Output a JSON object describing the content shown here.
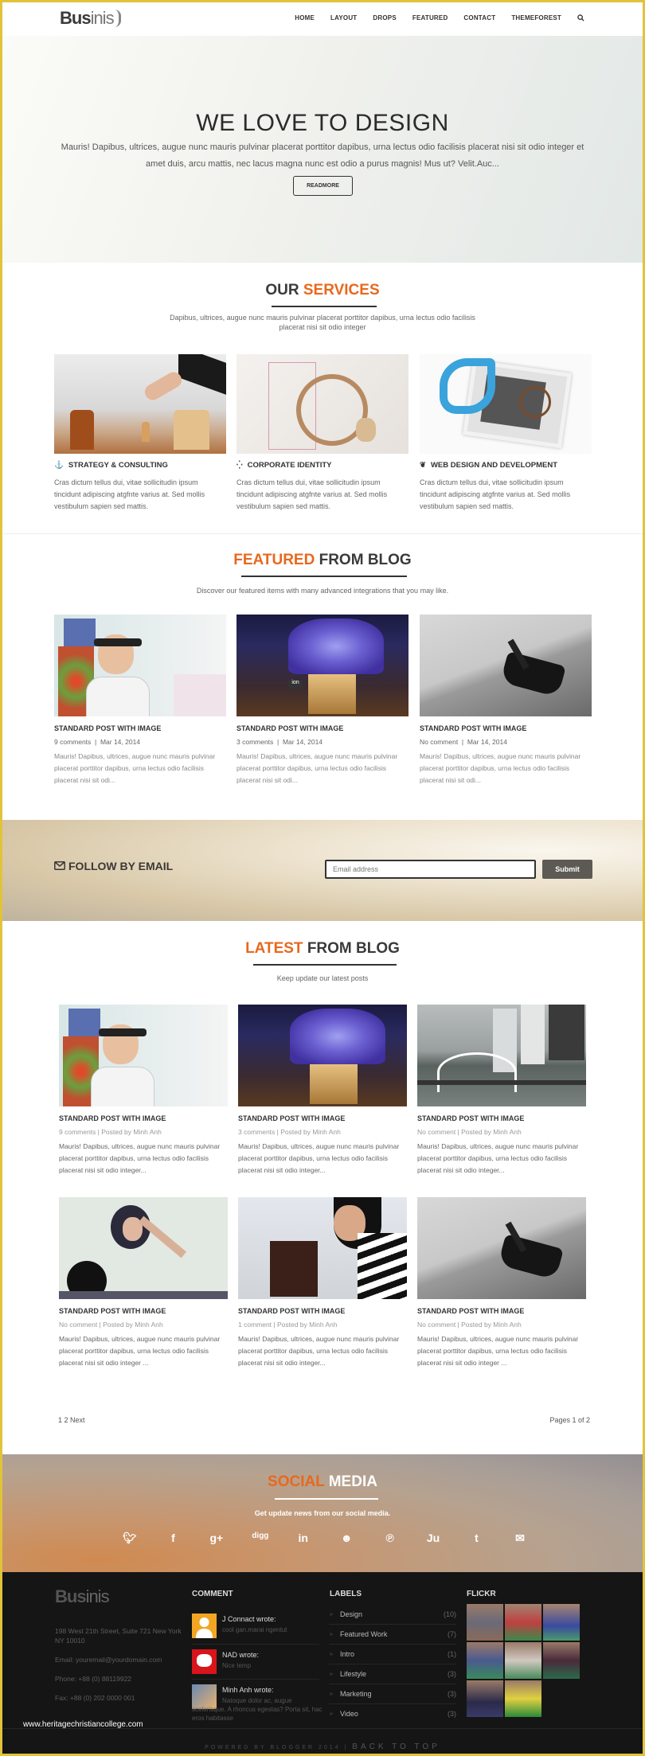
{
  "header": {
    "logo_bold": "Bus",
    "logo_light": "inis",
    "nav": [
      "HOME",
      "LAYOUT",
      "DROPS",
      "FEATURED",
      "CONTACT",
      "THEMEFOREST"
    ],
    "search_icon": "search-icon"
  },
  "hero": {
    "title": "WE LOVE TO DESIGN",
    "text": "Mauris! Dapibus, ultrices, augue nunc mauris pulvinar placerat porttitor dapibus, urna lectus odio facilisis placerat nisi sit odio integer et amet duis, arcu mattis, nec lacus magna nunc est odio a purus magnis! Mus ut? Velit.Auc...",
    "button": "READMORE"
  },
  "services": {
    "title_dark": "OUR",
    "title_accent": "SERVICES",
    "subtitle": "Dapibus, ultrices, augue nunc mauris pulvinar placerat porttitor dapibus, urna lectus odio facilisis placerat nisi sit odio integer",
    "items": [
      {
        "icon": "anchor-icon",
        "glyph": "⚓",
        "title": "STRATEGY & CONSULTING",
        "text": "Cras dictum tellus dui, vitae sollicitudin ipsum tincidunt adipiscing atgfnte varius at. Sed mollis vestibulum sapien sed mattis."
      },
      {
        "icon": "spinner-icon",
        "glyph": "⁛",
        "title": "CORPORATE IDENTITY",
        "text": "Cras dictum tellus dui, vitae sollicitudin ipsum tincidunt adipiscing atgfnte varius at. Sed mollis vestibulum sapien sed mattis."
      },
      {
        "icon": "leaf-icon",
        "glyph": "❦",
        "title": "WEB DESIGN AND DEVELOPMENT",
        "text": "Cras dictum tellus dui, vitae sollicitudin ipsum tincidunt adipiscing atgfnte varius at. Sed mollis vestibulum sapien sed mattis."
      }
    ]
  },
  "featured": {
    "title_accent": "FEATURED",
    "title_dark": "FROM BLOG",
    "subtitle": "Discover our featured items with many advanced integrations that you may like.",
    "posts": [
      {
        "title": "STANDARD POST WITH IMAGE",
        "comments": "9 comments",
        "date": "Mar 14, 2014",
        "excerpt": "Mauris! Dapibus, ultrices, augue nunc mauris pulvinar placerat porttitor dapibus, urna lectus odio facilisis placerat nisi sit odi..."
      },
      {
        "title": "STANDARD POST WITH IMAGE",
        "comments": "3 comments",
        "date": "Mar 14, 2014",
        "excerpt": "Mauris! Dapibus, ultrices, augue nunc mauris pulvinar placerat porttitor dapibus, urna lectus odio facilisis placerat nisi sit odi..."
      },
      {
        "title": "STANDARD POST WITH IMAGE",
        "comments": "No comment",
        "date": "Mar 14, 2014",
        "excerpt": "Mauris! Dapibus, ultrices, augue nunc mauris pulvinar placerat porttitor dapibus, urna lectus odio facilisis placerat nisi sit odi..."
      }
    ]
  },
  "follow": {
    "title": "FOLLOW BY EMAIL",
    "placeholder": "Email address",
    "button": "Submit"
  },
  "latest": {
    "title_accent": "LATEST",
    "title_dark": "FROM BLOG",
    "subtitle": "Keep update our latest posts",
    "posts": [
      {
        "title": "STANDARD POST WITH IMAGE",
        "meta": "9 comments | Posted by Minh Anh",
        "excerpt": "Mauris! Dapibus, ultrices, augue nunc mauris pulvinar placerat porttitor dapibus, urna lectus odio facilisis placerat nisi sit odio integer..."
      },
      {
        "title": "STANDARD POST WITH IMAGE",
        "meta": "3 comments | Posted by Minh Anh",
        "excerpt": "Mauris! Dapibus, ultrices, augue nunc mauris pulvinar placerat porttitor dapibus, urna lectus odio facilisis placerat nisi sit odio integer..."
      },
      {
        "title": "STANDARD POST WITH IMAGE",
        "meta": "No comment | Posted by Minh Anh",
        "excerpt": "Mauris! Dapibus, ultrices, augue nunc mauris pulvinar placerat porttitor dapibus, urna lectus odio facilisis placerat nisi sit odio integer..."
      },
      {
        "title": "STANDARD POST WITH IMAGE",
        "meta": "No comment | Posted by Minh Anh",
        "excerpt": "Mauris! Dapibus, ultrices, augue nunc mauris pulvinar placerat porttitor dapibus, urna lectus odio facilisis placerat nisi sit odio integer ..."
      },
      {
        "title": "STANDARD POST WITH IMAGE",
        "meta": "1 comment | Posted by Minh Anh",
        "excerpt": "Mauris! Dapibus, ultrices, augue nunc mauris pulvinar placerat porttitor dapibus, urna lectus odio facilisis placerat nisi sit odio integer..."
      },
      {
        "title": "STANDARD POST WITH IMAGE",
        "meta": "No comment | Posted by Minh Anh",
        "excerpt": "Mauris! Dapibus, ultrices, augue nunc mauris pulvinar placerat porttitor dapibus, urna lectus odio facilisis placerat nisi sit odio integer ..."
      }
    ],
    "pager": "1 2 Next",
    "pages": "Pages 1 of 2"
  },
  "social": {
    "title_accent": "SOCIAL",
    "title_light": "MEDIA",
    "subtitle": "Get update news from our social media.",
    "icons": [
      {
        "name": "twitter-icon",
        "glyph": "🐦︎"
      },
      {
        "name": "facebook-icon",
        "glyph": "f"
      },
      {
        "name": "google-plus-icon",
        "glyph": "g+"
      },
      {
        "name": "digg-icon",
        "glyph": "digg"
      },
      {
        "name": "linkedin-icon",
        "glyph": "in"
      },
      {
        "name": "reddit-icon",
        "glyph": "☻"
      },
      {
        "name": "pinterest-icon",
        "glyph": "℗"
      },
      {
        "name": "stumbleupon-icon",
        "glyph": "Ju"
      },
      {
        "name": "tumblr-icon",
        "glyph": "t"
      },
      {
        "name": "email-icon",
        "glyph": "✉"
      }
    ]
  },
  "footer": {
    "logo_bold": "Bus",
    "logo_light": "inis",
    "address": "198 West 21th Street, Suite 721 New York NY 10010",
    "email": "Email: youremail@yourdomain.com",
    "phone": "Phone: +88 (0) 88119922",
    "fax": "Fax: +88 (0) 202 0000 001",
    "comment_title": "COMMENT",
    "comments": [
      {
        "who": "J Connact wrote:",
        "text": "cool gan.marai ngentut"
      },
      {
        "who": "NAD wrote:",
        "text": "Nice temp"
      },
      {
        "who": "Minh Anh wrote:",
        "text": "Natoque dolor ac, augue scelerisque. A rhoncus egestas? Porta sit, hac eros habitasse"
      }
    ],
    "labels_title": "LABELS",
    "labels": [
      {
        "name": "Design",
        "count": "(10)"
      },
      {
        "name": "Featured Work",
        "count": "(7)"
      },
      {
        "name": "Intro",
        "count": "(1)"
      },
      {
        "name": "Lifestyle",
        "count": "(3)"
      },
      {
        "name": "Marketing",
        "count": "(3)"
      },
      {
        "name": "Video",
        "count": "(3)"
      }
    ],
    "flickr_title": "FLICKR",
    "powered": "POWERED BY BLOGGER 2014 |",
    "back_to_top": "BACK TO TOP"
  },
  "watermark": "www.heritagechristiancollege.com",
  "colors": {
    "accent": "#e8681e",
    "dark": "#333333",
    "footer_bg": "#151515"
  }
}
